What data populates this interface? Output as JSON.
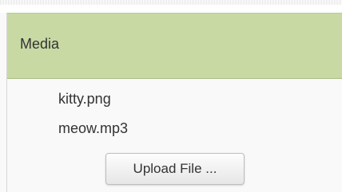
{
  "media_panel": {
    "title": "Media",
    "assets": [
      {
        "name": "kitty.png"
      },
      {
        "name": "meow.mp3"
      }
    ],
    "upload_label": "Upload File ..."
  },
  "colors": {
    "header_bg": "#c8d9a4",
    "panel_bg": "#f9f9f9",
    "text": "#333333"
  }
}
